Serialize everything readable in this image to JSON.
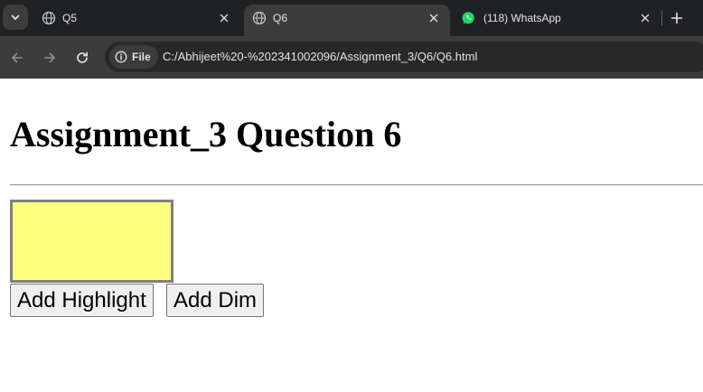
{
  "browser": {
    "tabs": [
      {
        "title": "Q5",
        "favicon": "globe-icon",
        "active": false
      },
      {
        "title": "Q6",
        "favicon": "globe-icon",
        "active": true
      },
      {
        "title": "(118) WhatsApp",
        "favicon": "whatsapp-icon",
        "active": false
      }
    ],
    "site_chip_label": "File",
    "url": "C:/Abhijeet%20-%202341002096/Assignment_3/Q6/Q6.html",
    "colors": {
      "tabstrip": "#202124",
      "active_tab": "#3c3c3c",
      "omnibox": "#282828",
      "whatsapp": "#25d366"
    }
  },
  "page": {
    "heading": "Assignment_3 Question 6",
    "box": {
      "fill": "#ffff80",
      "border": "#808080"
    },
    "buttons": {
      "highlight_label": "Add Highlight",
      "dim_label": "Add Dim"
    }
  }
}
